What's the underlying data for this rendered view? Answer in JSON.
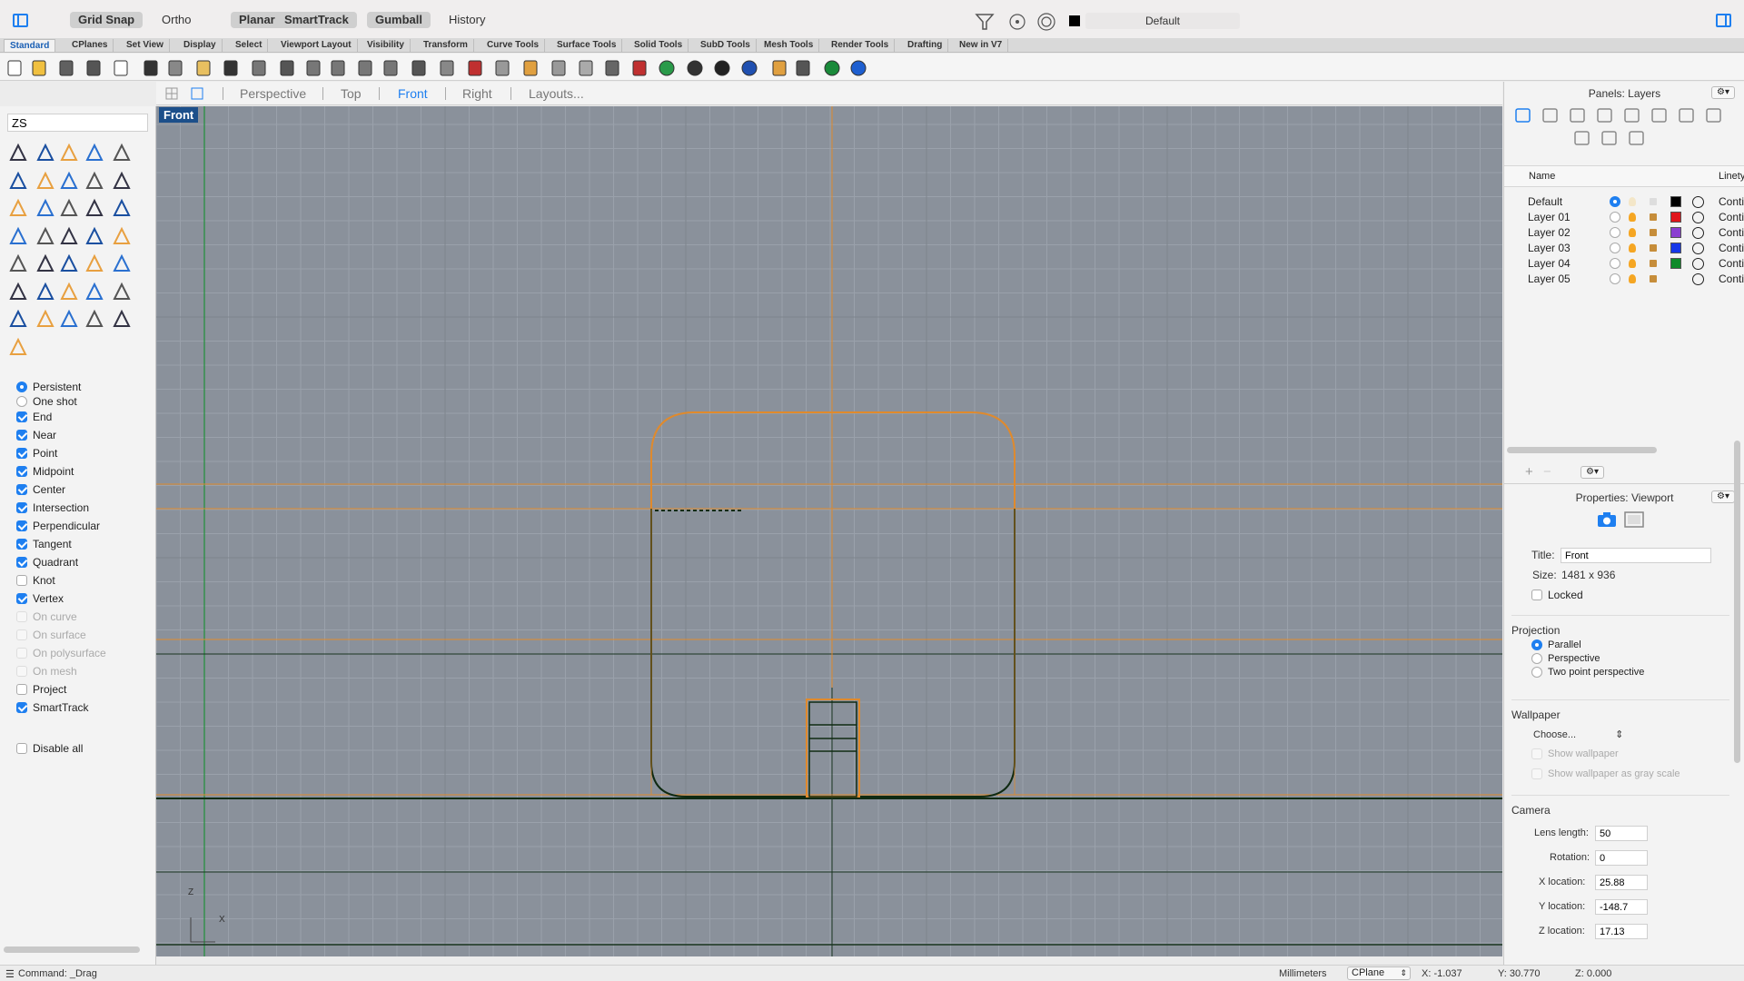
{
  "titlebar": {
    "grid_snap": "Grid Snap",
    "ortho": "Ortho",
    "planar": "Planar",
    "smarttrack": "SmartTrack",
    "gumball": "Gumball",
    "history": "History",
    "current_layer": "Default",
    "current_layer_color": "#000000"
  },
  "tabs": [
    "Standard",
    "CPlanes",
    "Set View",
    "Display",
    "Select",
    "Viewport Layout",
    "Visibility",
    "Transform",
    "Curve Tools",
    "Surface Tools",
    "Solid Tools",
    "SubD Tools",
    "Mesh Tools",
    "Render Tools",
    "Drafting",
    "New in V7"
  ],
  "toolbar_icons": [
    "new-document-icon",
    "open-folder-icon",
    "save-icon",
    "print-icon",
    "import-icon",
    "cut-icon",
    "copy-icon",
    "paste-icon",
    "undo-icon",
    "pan-hand-icon",
    "rotate-view-icon",
    "zoom-icon",
    "zoom-window-icon",
    "zoom-extents-icon",
    "zoom-selected-icon",
    "rotate-view-2-icon",
    "four-views-icon",
    "car-icon",
    "car-2-icon",
    "object-snap-icon",
    "grid-icon",
    "light-bulb-icon",
    "lock-icon",
    "layer-icon",
    "color-wheel-icon",
    "sphere-icon",
    "render-icon",
    "render-preview-icon",
    "filter-icon",
    "arrange-icon",
    "globe-icon",
    "help-icon"
  ],
  "viewport_tabs": {
    "perspective": "Perspective",
    "top": "Top",
    "front": "Front",
    "right": "Right",
    "layouts": "Layouts..."
  },
  "left_panel": {
    "search_value": "ZS",
    "snap_modes": [
      {
        "label": "Persistent",
        "selected": true
      },
      {
        "label": "One shot",
        "selected": false
      }
    ],
    "osnaps": [
      {
        "label": "End",
        "checked": true,
        "enabled": true
      },
      {
        "label": "Near",
        "checked": true,
        "enabled": true
      },
      {
        "label": "Point",
        "checked": true,
        "enabled": true
      },
      {
        "label": "Midpoint",
        "checked": true,
        "enabled": true
      },
      {
        "label": "Center",
        "checked": true,
        "enabled": true
      },
      {
        "label": "Intersection",
        "checked": true,
        "enabled": true
      },
      {
        "label": "Perpendicular",
        "checked": true,
        "enabled": true
      },
      {
        "label": "Tangent",
        "checked": true,
        "enabled": true
      },
      {
        "label": "Quadrant",
        "checked": true,
        "enabled": true
      },
      {
        "label": "Knot",
        "checked": false,
        "enabled": true
      },
      {
        "label": "Vertex",
        "checked": true,
        "enabled": true
      },
      {
        "label": "On curve",
        "checked": false,
        "enabled": false
      },
      {
        "label": "On surface",
        "checked": false,
        "enabled": false
      },
      {
        "label": "On polysurface",
        "checked": false,
        "enabled": false
      },
      {
        "label": "On mesh",
        "checked": false,
        "enabled": false
      },
      {
        "label": "Project",
        "checked": false,
        "enabled": true
      },
      {
        "label": "SmartTrack",
        "checked": true,
        "enabled": true
      }
    ],
    "disable_all": "Disable all"
  },
  "viewport": {
    "label": "Front",
    "axis_z": "Z",
    "axis_x": "X"
  },
  "layers_panel": {
    "title": "Panels: Layers",
    "col_name": "Name",
    "col_linetype": "Linety",
    "layers": [
      {
        "name": "Default",
        "color": "#000000",
        "current": true,
        "linetype": "Conti..."
      },
      {
        "name": "Layer 01",
        "color": "#e0161c",
        "current": false,
        "linetype": "Conti..."
      },
      {
        "name": "Layer 02",
        "color": "#8a3fd1",
        "current": false,
        "linetype": "Conti..."
      },
      {
        "name": "Layer 03",
        "color": "#1537e8",
        "current": false,
        "linetype": "Conti..."
      },
      {
        "name": "Layer 04",
        "color": "#0f8a2a",
        "current": false,
        "linetype": "Conti..."
      },
      {
        "name": "Layer 05",
        "color": "",
        "current": false,
        "linetype": "Conti..."
      }
    ]
  },
  "properties_panel": {
    "title": "Properties: Viewport",
    "title_label": "Title:",
    "title_value": "Front",
    "size_label": "Size:",
    "size_value": "1481 x 936",
    "locked_label": "Locked",
    "projection_title": "Projection",
    "projections": [
      {
        "label": "Parallel",
        "selected": true
      },
      {
        "label": "Perspective",
        "selected": false
      },
      {
        "label": "Two point perspective",
        "selected": false
      }
    ],
    "wallpaper_title": "Wallpaper",
    "wallpaper_choose": "Choose...",
    "show_wallpaper": "Show wallpaper",
    "show_wallpaper_gray": "Show wallpaper as gray scale",
    "camera_title": "Camera",
    "lens_label": "Lens length:",
    "lens_value": "50",
    "rotation_label": "Rotation:",
    "rotation_value": "0",
    "x_label": "X location:",
    "x_value": "25.88",
    "y_label": "Y location:",
    "y_value": "-148.7",
    "z_label": "Z location:",
    "z_value": "17.13"
  },
  "statusbar": {
    "command": "Command: _Drag",
    "units": "Millimeters",
    "cplane": "CPlane",
    "x": "X: -1.037",
    "y": "Y: 30.770",
    "z": "Z: 0.000"
  }
}
